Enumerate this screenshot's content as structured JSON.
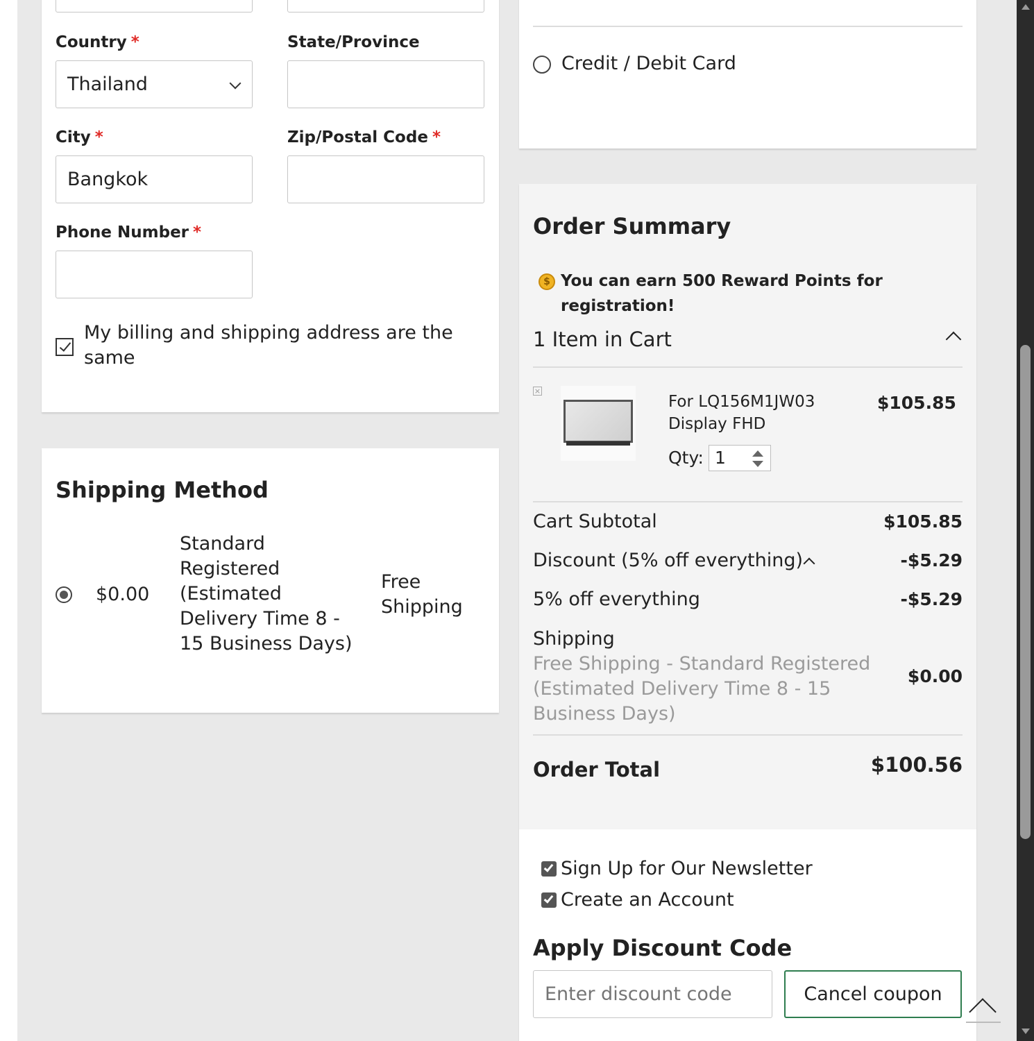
{
  "address_form": {
    "country_label": "Country",
    "country_value": "Thailand",
    "state_label": "State/Province",
    "state_value": "",
    "city_label": "City",
    "city_value": "Bangkok",
    "zip_label": "Zip/Postal Code",
    "zip_value": "",
    "phone_label": "Phone Number",
    "phone_value": "",
    "required_mark": "*",
    "same_address_label": "My billing and shipping address are the same",
    "same_address_checked": true
  },
  "shipping_method": {
    "title": "Shipping Method",
    "options": [
      {
        "price": "$0.00",
        "method": "Standard Registered (Estimated Delivery Time 8 - 15 Business Days)",
        "carrier": "Free Shipping",
        "selected": true
      }
    ]
  },
  "payment": {
    "option_label": "Credit / Debit Card",
    "selected": false
  },
  "order_summary": {
    "title": "Order Summary",
    "reward_prefix": "You can earn ",
    "reward_bold": "500 Reward Points",
    "reward_suffix": " for registration!",
    "items_header": "1 Item in Cart",
    "item": {
      "name": "For LQ156M1JW03 Display FHD",
      "price": "$105.85",
      "qty_label": "Qty:",
      "qty_value": "1"
    },
    "totals": {
      "subtotal_label": "Cart Subtotal",
      "subtotal_value": "$105.85",
      "discount_label": "Discount (5% off everything)",
      "discount_value": "-$5.29",
      "discount_detail_label": "5% off everything",
      "discount_detail_value": "-$5.29",
      "shipping_label": "Shipping",
      "shipping_detail": "Free Shipping - Standard Registered (Estimated Delivery Time 8 - 15 Business Days)",
      "shipping_value": "$0.00",
      "order_total_label": "Order Total",
      "order_total_value": "$100.56"
    },
    "newsletter_label": "Sign Up for Our Newsletter",
    "newsletter_checked": true,
    "create_account_label": "Create an Account",
    "create_account_checked": true,
    "discount_code_title": "Apply Discount Code",
    "discount_code_placeholder": "Enter discount code",
    "cancel_coupon_label": "Cancel coupon"
  },
  "colors": {
    "required": "#e02b27",
    "button_border": "#2e7d4f",
    "page_bg": "#e9e9e9"
  },
  "icons": [
    "chevron-down-icon",
    "checkbox-icon",
    "radio-icon",
    "coin-icon",
    "chevron-up-icon",
    "remove-item-icon",
    "spinner-icon",
    "back-to-top-icon"
  ]
}
